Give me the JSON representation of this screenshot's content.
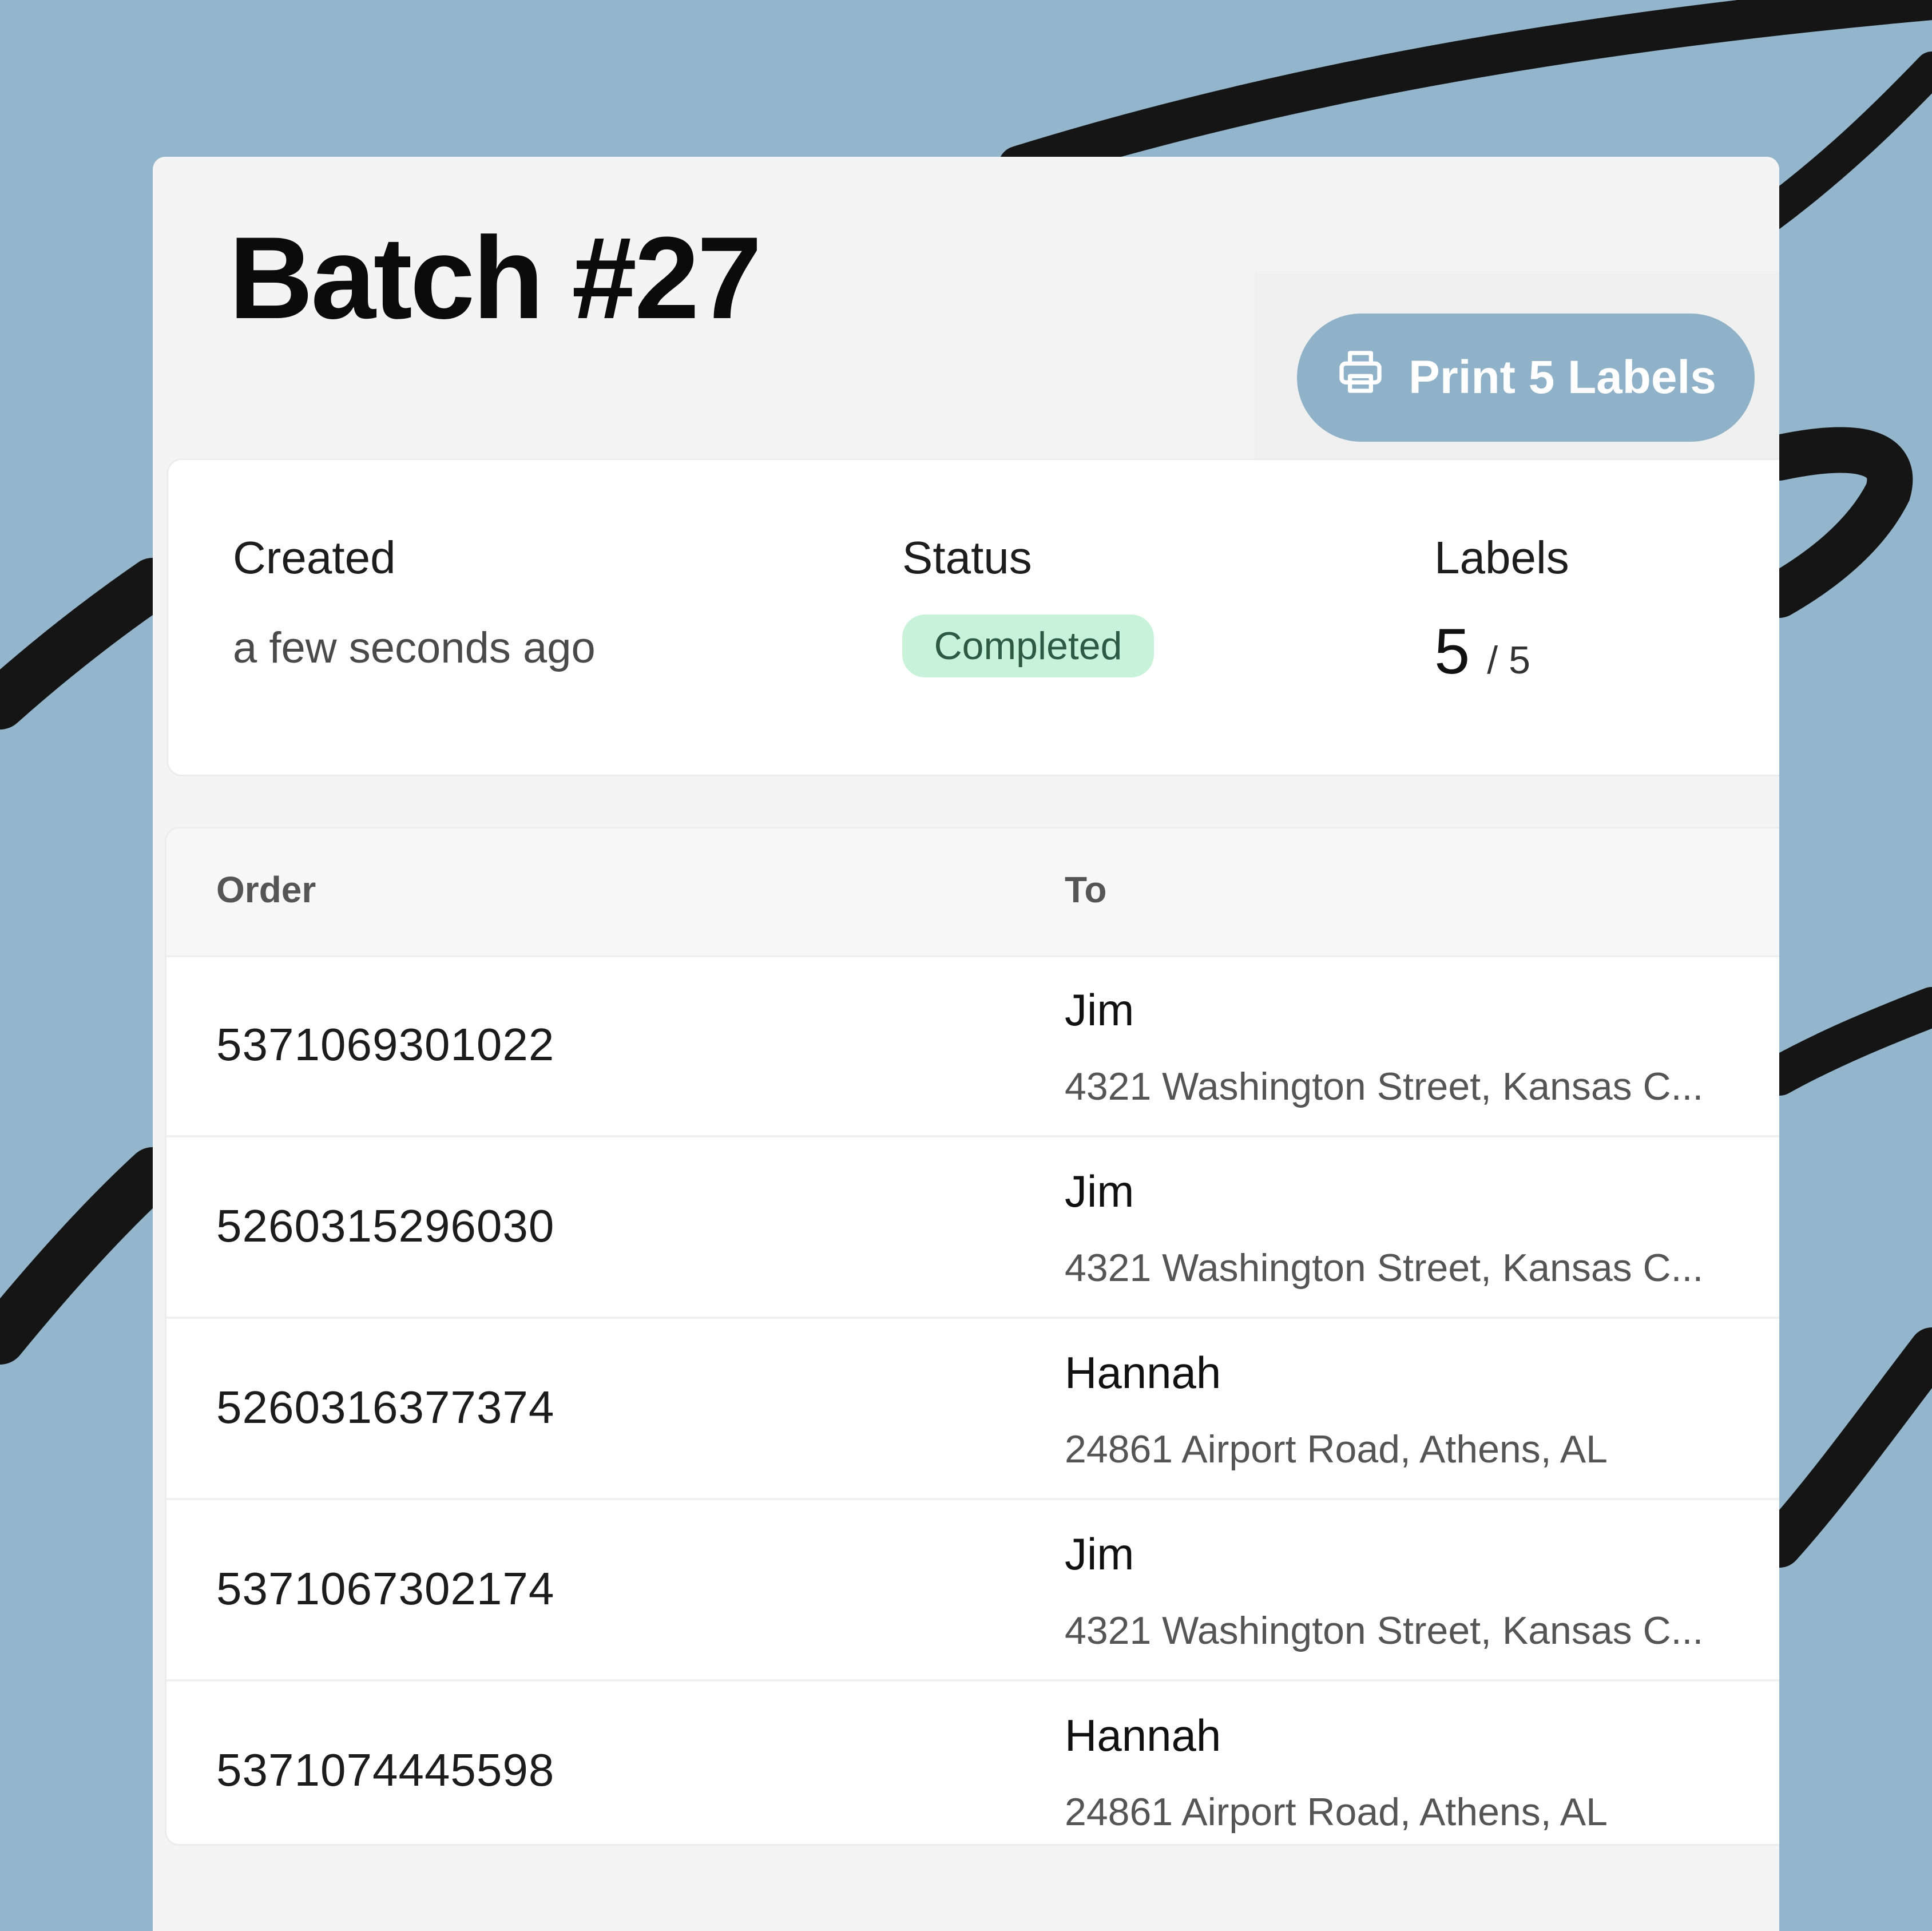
{
  "batch": {
    "title": "Batch #27",
    "print_button_label": "Print 5 Labels"
  },
  "summary": {
    "created_label": "Created",
    "created_value": "a few seconds ago",
    "status_label": "Status",
    "status_value": "Completed",
    "labels_label": "Labels",
    "labels_done": "5",
    "labels_total": "/ 5"
  },
  "table": {
    "headers": {
      "order": "Order",
      "to": "To"
    },
    "rows": [
      {
        "order": "5371069301022",
        "name": "Jim",
        "address": "4321 Washington Street, Kansas C..."
      },
      {
        "order": "5260315296030",
        "name": "Jim",
        "address": "4321 Washington Street, Kansas C..."
      },
      {
        "order": "5260316377374",
        "name": "Hannah",
        "address": "24861 Airport Road, Athens, AL"
      },
      {
        "order": "5371067302174",
        "name": "Jim",
        "address": "4321 Washington Street, Kansas C..."
      },
      {
        "order": "5371074445598",
        "name": "Hannah",
        "address": "24861 Airport Road, Athens, AL"
      }
    ]
  },
  "colors": {
    "background": "#93b6cc",
    "print_button": "#8fb2c8",
    "status_badge_bg": "#c9f2da",
    "status_badge_text": "#2d5a44"
  },
  "icons": {
    "print_button": "printer-icon"
  }
}
